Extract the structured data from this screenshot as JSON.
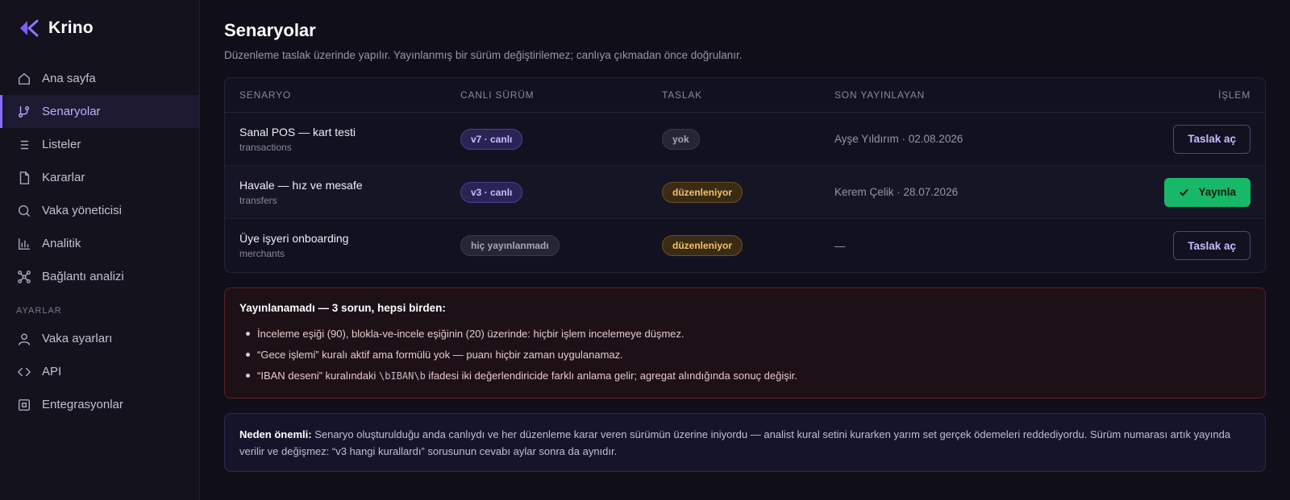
{
  "app": {
    "name": "Krino",
    "accent": "#8b6cff"
  },
  "sidebar": {
    "items": [
      {
        "label": "Ana sayfa",
        "icon": "home-icon"
      },
      {
        "label": "Senaryolar",
        "icon": "branch-icon",
        "active": true
      },
      {
        "label": "Listeler",
        "icon": "list-icon"
      },
      {
        "label": "Kararlar",
        "icon": "document-icon"
      },
      {
        "label": "Vaka yöneticisi",
        "icon": "search-icon"
      },
      {
        "label": "Analitik",
        "icon": "bar-chart-icon"
      },
      {
        "label": "Bağlantı analizi",
        "icon": "network-icon"
      }
    ],
    "settings_label": "AYARLAR",
    "settings_items": [
      {
        "label": "Vaka ayarları",
        "icon": "user-icon"
      },
      {
        "label": "API",
        "icon": "code-icon"
      },
      {
        "label": "Entegrasyonlar",
        "icon": "chip-icon"
      }
    ]
  },
  "page": {
    "title": "Senaryolar",
    "subtitle": "Düzenleme taslak üzerinde yapılır. Yayınlanmış bir sürüm değiştirilemez; canlıya çıkmadan önce doğrulanır."
  },
  "table": {
    "headers": [
      "SENARYO",
      "CANLI SÜRÜM",
      "TASLAK",
      "SON YAYINLAYAN",
      "İŞLEM"
    ],
    "rows": [
      {
        "name": "Sanal POS — kart testi",
        "source": "transactions",
        "live": "v7 · canlı",
        "draft": "yok",
        "last": "Ayşe Yıldırım · 02.08.2026",
        "action": "Taslak aç"
      },
      {
        "name": "Havale — hız ve mesafe",
        "source": "transfers",
        "live": "v3 · canlı",
        "draft": "düzenleniyor",
        "last": "Kerem Çelik · 28.07.2026",
        "action": "Yayınla"
      },
      {
        "name": "Üye işyeri onboarding",
        "source": "merchants",
        "live": "hiç yayınlanmadı",
        "draft": "düzenleniyor",
        "last": "—",
        "action": "Taslak aç"
      }
    ]
  },
  "alert": {
    "title": "Yayınlanamadı — 3 sorun, hepsi birden:",
    "items": [
      "İnceleme eşiği (90), blokla-ve-incele eşiğinin (20) üzerinde: hiçbir işlem incelemeye düşmez.",
      "“Gece işlemi” kuralı aktif ama formülü yok — puanı hiçbir zaman uygulanamaz."
    ],
    "item3_pre": "“IBAN deseni” kuralındaki ",
    "item3_code": "\\bIBAN\\b",
    "item3_post": " ifadesi iki değerlendiricide farklı anlama gelir; agregat alındığında sonuç değişir."
  },
  "info": {
    "label": "Neden önemli:",
    "text": " Senaryo oluşturulduğu anda canlıydı ve her düzenleme karar veren sürümün üzerine iniyordu — analist kural setini kurarken yarım set gerçek ödemeleri reddediyordu. Sürüm numarası artık yayında verilir ve değişmez: “v3 hangi kurallardı” sorusunun cevabı aylar sonra da aynıdır."
  }
}
